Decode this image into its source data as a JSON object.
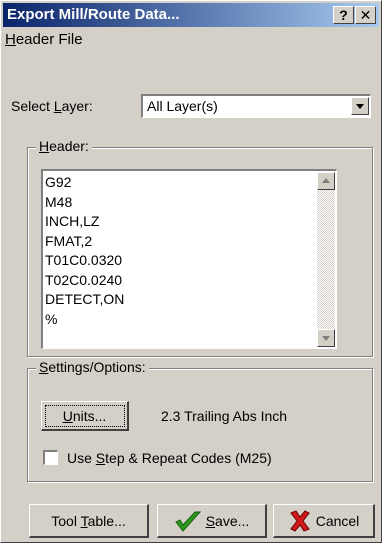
{
  "window": {
    "title": "Export Mill/Route Data...",
    "help_button": "?",
    "close_button": "X"
  },
  "menu": {
    "header_file": "Header File"
  },
  "select_layer": {
    "label": "Select Layer:",
    "value": "All Layer(s)"
  },
  "header_group": {
    "legend": "Header:",
    "lines": [
      "G92",
      "M48",
      "INCH,LZ",
      "FMAT,2",
      "T01C0.0320",
      "T02C0.0240",
      "DETECT,ON",
      "%"
    ]
  },
  "settings_group": {
    "legend": "Settings/Options:",
    "units_button": "Units...",
    "units_value": "2.3 Trailing Abs Inch",
    "step_repeat_label": "Use Step & Repeat Codes (M25)",
    "step_repeat_checked": false
  },
  "buttons": {
    "tool_table": "Tool Table...",
    "save": "Save...",
    "cancel": "Cancel"
  },
  "icons": {
    "save": "green-checkmark-icon",
    "cancel": "red-x-icon"
  }
}
